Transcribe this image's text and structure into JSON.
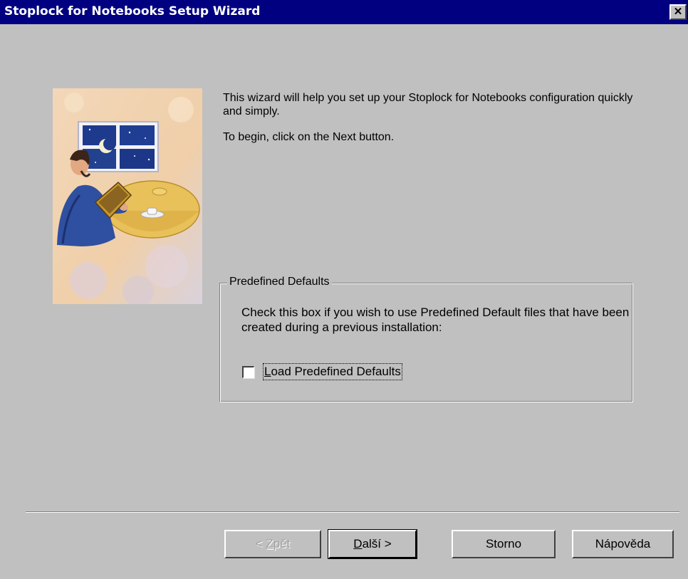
{
  "window": {
    "title": "Stoplock for Notebooks Setup Wizard",
    "close_symbol": "✕",
    "close_icon": "close-icon"
  },
  "illustration": {
    "icon": "wizard-illustration-man-with-laptop-at-night-window"
  },
  "intro": {
    "line1": "This wizard will help you set up your Stoplock for Notebooks configuration quickly and simply.",
    "line2": "To begin, click on the Next button."
  },
  "predefined_defaults": {
    "legend": "Predefined Defaults",
    "description": "Check this box if you wish to use Predefined Default files that have been created during a previous installation:",
    "checkbox_label_mnemonic": "L",
    "checkbox_label_rest": "oad Predefined Defaults",
    "checked": false
  },
  "buttons": {
    "back_prefix": "< ",
    "back_mnemonic": "Z",
    "back_rest": "pět",
    "next_mnemonic": "D",
    "next_rest": "alší >",
    "cancel": "Storno",
    "help": "Nápověda"
  },
  "colors": {
    "titlebar": "#000080",
    "face": "#c0c0c0",
    "disabled_text": "#a0a0a0"
  }
}
